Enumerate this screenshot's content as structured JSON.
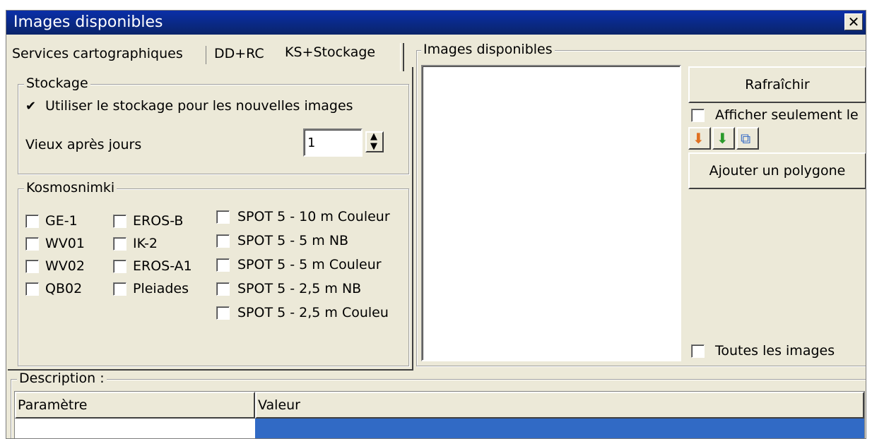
{
  "window": {
    "title": "Images disponibles",
    "close_glyph": "✕"
  },
  "tabs": [
    {
      "label": "Services cartographiques"
    },
    {
      "label": "DD+RC"
    },
    {
      "label": "KS+Stockage"
    }
  ],
  "stockage": {
    "group_title": "Stockage",
    "use_storage_label": "Utiliser le stockage pour les nouvelles images",
    "use_storage_checked": true,
    "old_after_label": "Vieux après jours",
    "old_after_value": "1"
  },
  "kosmosnimki": {
    "group_title": "Kosmosnimki",
    "col1": [
      {
        "label": "GE-1",
        "checked": false
      },
      {
        "label": "WV01",
        "checked": false
      },
      {
        "label": "WV02",
        "checked": false
      },
      {
        "label": "QB02",
        "checked": false
      }
    ],
    "col2": [
      {
        "label": "EROS-B",
        "checked": false
      },
      {
        "label": "IK-2",
        "checked": false
      },
      {
        "label": "EROS-A1",
        "checked": false
      },
      {
        "label": "Pleiades",
        "checked": false
      }
    ],
    "col3": [
      {
        "label": "SPOT 5 - 10 m Couleur",
        "checked": false
      },
      {
        "label": "SPOT 5 - 5 m NB",
        "checked": false
      },
      {
        "label": "SPOT 5 - 5 m Couleur",
        "checked": false
      },
      {
        "label": "SPOT 5 - 2,5 m NB",
        "checked": false
      },
      {
        "label": "SPOT 5 - 2,5 m Couleu",
        "checked": false
      }
    ]
  },
  "images_panel": {
    "group_title": "Images disponibles"
  },
  "right_controls": {
    "refresh_label": "Rafraîchir",
    "show_only_label": "Afficher seulement le",
    "add_polygon_label": "Ajouter un polygone",
    "all_images_label": "Toutes les images"
  },
  "description": {
    "group_title": "Description :",
    "headers": [
      "Paramètre",
      "Valeur"
    ]
  },
  "colors": {
    "title_bar": "#0a246a",
    "window_bg": "#ece9d8",
    "selection": "#316ac5"
  }
}
